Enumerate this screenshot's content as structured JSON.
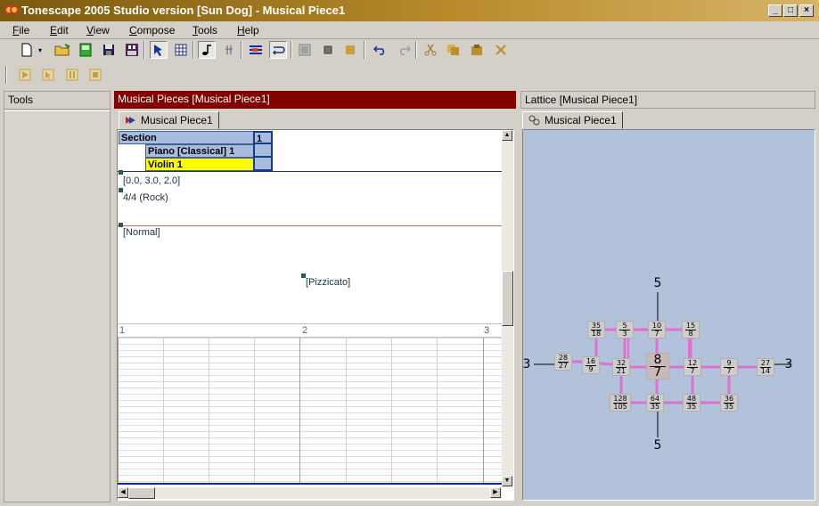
{
  "window": {
    "title": "Tonescape 2005 Studio  version [Sun Dog]  -  Musical Piece1",
    "controls": {
      "minimize": "_",
      "maximize": "□",
      "close": "×"
    }
  },
  "menu": {
    "items": [
      {
        "label": "File"
      },
      {
        "label": "Edit"
      },
      {
        "label": "View"
      },
      {
        "label": "Compose"
      },
      {
        "label": "Tools"
      },
      {
        "label": "Help"
      }
    ]
  },
  "panes": {
    "tools": {
      "header": "Tools"
    },
    "musical_pieces": {
      "header": "Musical Pieces  [Musical Piece1]",
      "tab": "Musical Piece1",
      "section_header": "Section",
      "section_number": "1",
      "instruments": [
        "Piano [Classical] 1",
        "Violin 1"
      ],
      "selected_instrument": "Violin 1",
      "events": {
        "tuning": "[0.0, 3.0, 2.0]",
        "meter": "4/4 (Rock)",
        "mode": "[Normal]",
        "articulation": "[Pizzicato]"
      },
      "ruler": [
        "1",
        "2",
        "3"
      ]
    },
    "lattice": {
      "header": "Lattice  [Musical Piece1]",
      "tab": "Musical Piece1",
      "axis_labels": {
        "top": "5",
        "bottom": "5",
        "left": "3",
        "right": "3"
      },
      "center_node": {
        "num": "8",
        "den": "7"
      },
      "nodes": [
        {
          "num": "35",
          "den": "18"
        },
        {
          "num": "5",
          "den": "3"
        },
        {
          "num": "10",
          "den": "7"
        },
        {
          "num": "15",
          "den": "8"
        },
        {
          "num": "28",
          "den": "27"
        },
        {
          "num": "16",
          "den": "9"
        },
        {
          "num": "32",
          "den": "21"
        },
        {
          "num": "12",
          "den": "7"
        },
        {
          "num": "9",
          "den": "7"
        },
        {
          "num": "27",
          "den": "14"
        },
        {
          "num": "128",
          "den": "105"
        },
        {
          "num": "64",
          "den": "35"
        },
        {
          "num": "48",
          "den": "35"
        },
        {
          "num": "36",
          "den": "35"
        }
      ]
    }
  },
  "colors": {
    "title_bar": "#a07820",
    "pane_header_active": "#800000",
    "lattice_background": "#b2c2da",
    "lattice_edge": "#e070d0",
    "selected_instrument": "#ffff00",
    "section_cell": "#a8bce0"
  }
}
